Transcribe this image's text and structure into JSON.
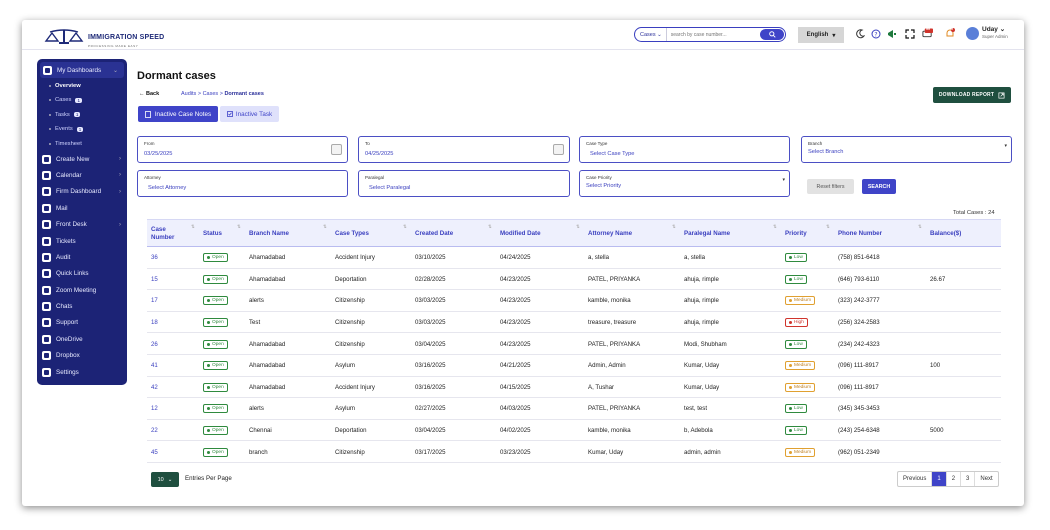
{
  "app": {
    "logo_text": "IMMIGRATION SPEED",
    "logo_sub": "PROCESSING MADE EASY"
  },
  "topbar": {
    "search_scope": "Cases",
    "search_placeholder": "search by case number...",
    "language": "English",
    "notif_count_a": "99",
    "notif_count_b": "9",
    "user_name": "Uday",
    "user_role": "Super Admin"
  },
  "sidebar": {
    "items": [
      {
        "label": "My Dashboards",
        "icon": "grid-icon",
        "chevron": "⌄"
      },
      {
        "label": "Create New",
        "icon": "plus-square-icon",
        "chevron": "›"
      },
      {
        "label": "Calendar",
        "icon": "calendar-icon",
        "chevron": "›"
      },
      {
        "label": "Firm Dashboard",
        "icon": "users-icon",
        "chevron": "›"
      },
      {
        "label": "Mail",
        "icon": "mail-icon",
        "chevron": ""
      },
      {
        "label": "Front Desk",
        "icon": "desk-icon",
        "chevron": "›"
      },
      {
        "label": "Tickets",
        "icon": "ticket-icon",
        "chevron": ""
      },
      {
        "label": "Audit",
        "icon": "audit-icon",
        "chevron": ""
      },
      {
        "label": "Quick Links",
        "icon": "link-icon",
        "chevron": ""
      },
      {
        "label": "Zoom Meeting",
        "icon": "video-icon",
        "chevron": ""
      },
      {
        "label": "Chats",
        "icon": "chat-icon",
        "chevron": ""
      },
      {
        "label": "Support",
        "icon": "support-icon",
        "chevron": ""
      },
      {
        "label": "OneDrive",
        "icon": "cloud-icon",
        "chevron": ""
      },
      {
        "label": "Dropbox",
        "icon": "dropbox-icon",
        "chevron": ""
      },
      {
        "label": "Settings",
        "icon": "gear-icon",
        "chevron": ""
      }
    ],
    "sub_items": [
      {
        "label": "Overview",
        "badge": ""
      },
      {
        "label": "Cases",
        "badge": "1"
      },
      {
        "label": "Tasks",
        "badge": "1"
      },
      {
        "label": "Events",
        "badge": "1"
      },
      {
        "label": "Timesheet",
        "badge": ""
      }
    ]
  },
  "page": {
    "title": "Dormant cases",
    "back_label": "Back",
    "crumb_1": "Audits",
    "crumb_2": "Cases",
    "crumb_3": "Dormant cases",
    "download_label": "DOWNLOAD REPORT",
    "tab_notes": "Inactive Case Notes",
    "tab_task": "Inactive Task"
  },
  "filters": {
    "from_label": "From",
    "from_value": "03/25/2025",
    "to_label": "To",
    "to_value": "04/25/2025",
    "case_type_label": "Case Type",
    "case_type_value": "Select Case Type",
    "branch_label": "Branch",
    "branch_value": "Select Branch",
    "attorney_label": "Attorney",
    "attorney_value": "Select Attorney",
    "paralegal_label": "Paralegal",
    "paralegal_value": "Select Paralegal",
    "priority_label": "Case Priority",
    "priority_value": "Select Priority",
    "reset_label": "Reset filters",
    "search_label": "SEARCH"
  },
  "table": {
    "total_label": "Total Cases : 24",
    "headers": [
      "Case Number",
      "Status",
      "Branch Name",
      "Case Types",
      "Created Date",
      "Modified Date",
      "Attorney Name",
      "Paralegal Name",
      "Priority",
      "Phone Number",
      "Balance($)"
    ],
    "rows": [
      {
        "case": "36",
        "status": "Open",
        "branch": "Ahamadabad",
        "type": "Accident Injury",
        "created": "03/10/2025",
        "modified": "04/24/2025",
        "attorney": "a, stella",
        "paralegal": "a, stella",
        "priority": "Low",
        "phone": "(758) 851-6418",
        "balance": ""
      },
      {
        "case": "15",
        "status": "Open",
        "branch": "Ahamadabad",
        "type": "Deportation",
        "created": "02/28/2025",
        "modified": "04/23/2025",
        "attorney": "PATEL, PRIYANKA",
        "paralegal": "ahuja, rimple",
        "priority": "Low",
        "phone": "(646) 793-6110",
        "balance": "26.67"
      },
      {
        "case": "17",
        "status": "Open",
        "branch": "alerts",
        "type": "Citizenship",
        "created": "03/03/2025",
        "modified": "04/23/2025",
        "attorney": "kamble, monika",
        "paralegal": "ahuja, rimple",
        "priority": "Medium",
        "phone": "(323) 242-3777",
        "balance": ""
      },
      {
        "case": "18",
        "status": "Open",
        "branch": "Test",
        "type": "Citizenship",
        "created": "03/03/2025",
        "modified": "04/23/2025",
        "attorney": "treasure, treasure",
        "paralegal": "ahuja, rimple",
        "priority": "High",
        "phone": "(256) 324-2583",
        "balance": ""
      },
      {
        "case": "26",
        "status": "Open",
        "branch": "Ahamadabad",
        "type": "Citizenship",
        "created": "03/04/2025",
        "modified": "04/23/2025",
        "attorney": "PATEL, PRIYANKA",
        "paralegal": "Modi, Shubham",
        "priority": "Low",
        "phone": "(234) 242-4323",
        "balance": ""
      },
      {
        "case": "41",
        "status": "Open",
        "branch": "Ahamadabad",
        "type": "Asylum",
        "created": "03/16/2025",
        "modified": "04/21/2025",
        "attorney": "Admin, Admin",
        "paralegal": "Kumar, Uday",
        "priority": "Medium",
        "phone": "(096) 111-8917",
        "balance": "100"
      },
      {
        "case": "42",
        "status": "Open",
        "branch": "Ahamadabad",
        "type": "Accident Injury",
        "created": "03/16/2025",
        "modified": "04/15/2025",
        "attorney": "A, Tushar",
        "paralegal": "Kumar, Uday",
        "priority": "Medium",
        "phone": "(096) 111-8917",
        "balance": ""
      },
      {
        "case": "12",
        "status": "Open",
        "branch": "alerts",
        "type": "Asylum",
        "created": "02/27/2025",
        "modified": "04/03/2025",
        "attorney": "PATEL, PRIYANKA",
        "paralegal": "test, test",
        "priority": "Low",
        "phone": "(345) 345-3453",
        "balance": ""
      },
      {
        "case": "22",
        "status": "Open",
        "branch": "Chennai",
        "type": "Deportation",
        "created": "03/04/2025",
        "modified": "04/02/2025",
        "attorney": "kamble, monika",
        "paralegal": "b, Adebola",
        "priority": "Low",
        "phone": "(243) 254-6348",
        "balance": "5000"
      },
      {
        "case": "45",
        "status": "Open",
        "branch": "branch",
        "type": "Citizenship",
        "created": "03/17/2025",
        "modified": "03/23/2025",
        "attorney": "Kumar, Uday",
        "paralegal": "admin, admin",
        "priority": "Medium",
        "phone": "(962) 051-2349",
        "balance": ""
      }
    ]
  },
  "priority_colors": {
    "Low": "#2f8a3e",
    "Medium": "#e0a030",
    "High": "#d0342c"
  },
  "footer": {
    "per_page_value": "10",
    "per_page_label": "Entries Per Page",
    "prev_label": "Previous",
    "pages": [
      "1",
      "2",
      "3"
    ],
    "next_label": "Next"
  }
}
